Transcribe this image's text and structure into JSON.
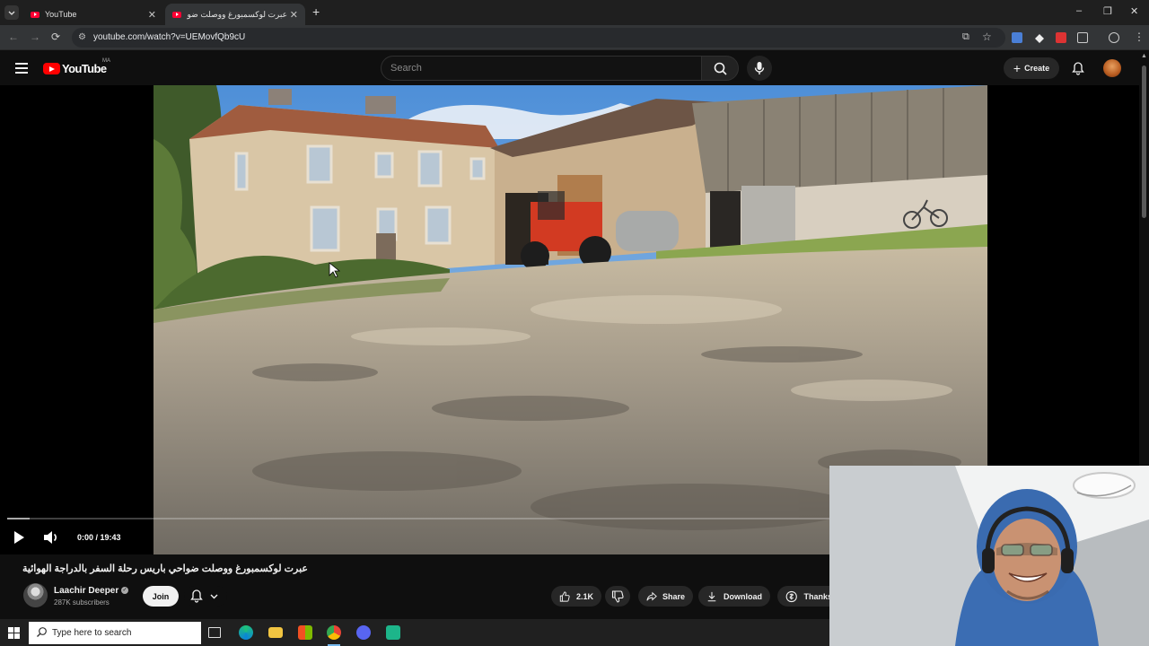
{
  "browser": {
    "tabs": [
      {
        "label": "YouTube",
        "active": false
      },
      {
        "label": "عبرت لوكسمبورغ ووصلت ضواح...",
        "active": true
      }
    ],
    "url": "youtube.com/watch?v=UEMovfQb9cU",
    "new_tab_label": "+",
    "window_controls": [
      "–",
      "❐",
      "✕"
    ]
  },
  "youtube": {
    "logo_text": "YouTube",
    "country_code": "MA",
    "search_placeholder": "Search",
    "create_label": "Create",
    "video": {
      "current_time": "0:00",
      "duration": "19:43",
      "time_display": "0:00 / 19:43",
      "progress_fraction": 0.02,
      "title": "عبرت لوكسمبورغ ووصلت ضواحي باريس رحلة السفر بالدراجة الهوائية"
    },
    "channel": {
      "name": "Laachir Deeper",
      "subscribers": "287K subscribers",
      "join_label": "Join"
    },
    "actions": {
      "likes": "2.1K",
      "share_label": "Share",
      "download_label": "Download",
      "thanks_label": "Thanks"
    }
  },
  "taskbar": {
    "search_placeholder": "Type here to search"
  },
  "colors": {
    "yt_red": "#ff0000",
    "background": "#0f0f0f",
    "taskbar": "#202020",
    "chrome_tabstrip": "#1f1f1f"
  }
}
